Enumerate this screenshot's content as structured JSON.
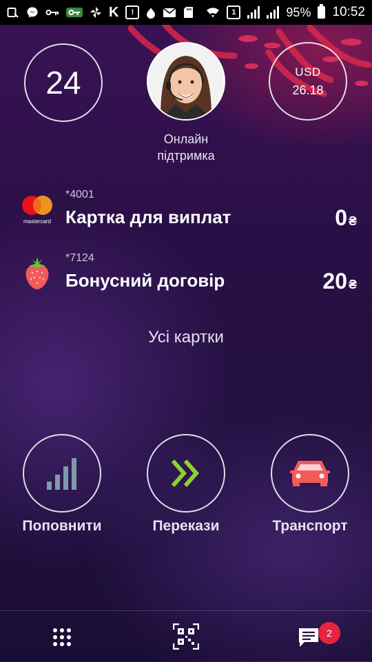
{
  "status_bar": {
    "battery_percent": "95%",
    "time": "10:52",
    "left_icons": [
      "screen-icon",
      "messenger-icon",
      "key-icon",
      "key-green-icon",
      "pinwheel-icon",
      "k-icon",
      "alert-box-icon",
      "drop-icon",
      "mail-icon",
      "sd-card-icon"
    ],
    "right_icons": [
      "wifi-icon",
      "sim-1-icon",
      "signal-icon",
      "signal-icon-2",
      "battery-icon"
    ],
    "k_glyph": "K",
    "sim_label": "1"
  },
  "header": {
    "days_value": "24",
    "support_label_line1": "Онлайн",
    "support_label_line2": "підтримка",
    "currency_code": "USD",
    "currency_rate": "26.18"
  },
  "cards": [
    {
      "mask": "*4001",
      "name": "Картка для виплат",
      "amount": "0",
      "currency_symbol": "₴",
      "icon": "mastercard-icon",
      "brand_text": "mastercard"
    },
    {
      "mask": "*7124",
      "name": "Бонусний договір",
      "amount": "20",
      "currency_symbol": "₴",
      "icon": "strawberry-icon"
    }
  ],
  "all_cards_label": "Усі картки",
  "actions": [
    {
      "label": "Поповнити",
      "icon": "signal-bars-icon"
    },
    {
      "label": "Перекази",
      "icon": "double-chevron-right-icon"
    },
    {
      "label": "Транспорт",
      "icon": "car-icon"
    }
  ],
  "bottom_bar": {
    "items": [
      "grid-menu-icon",
      "qr-code-icon",
      "chat-icon"
    ],
    "chat_badge": "2"
  },
  "colors": {
    "accent_red": "#e5243f",
    "green": "#8dd12f",
    "car": "#f25a5a",
    "signal_bars": "#7f9aa8"
  }
}
